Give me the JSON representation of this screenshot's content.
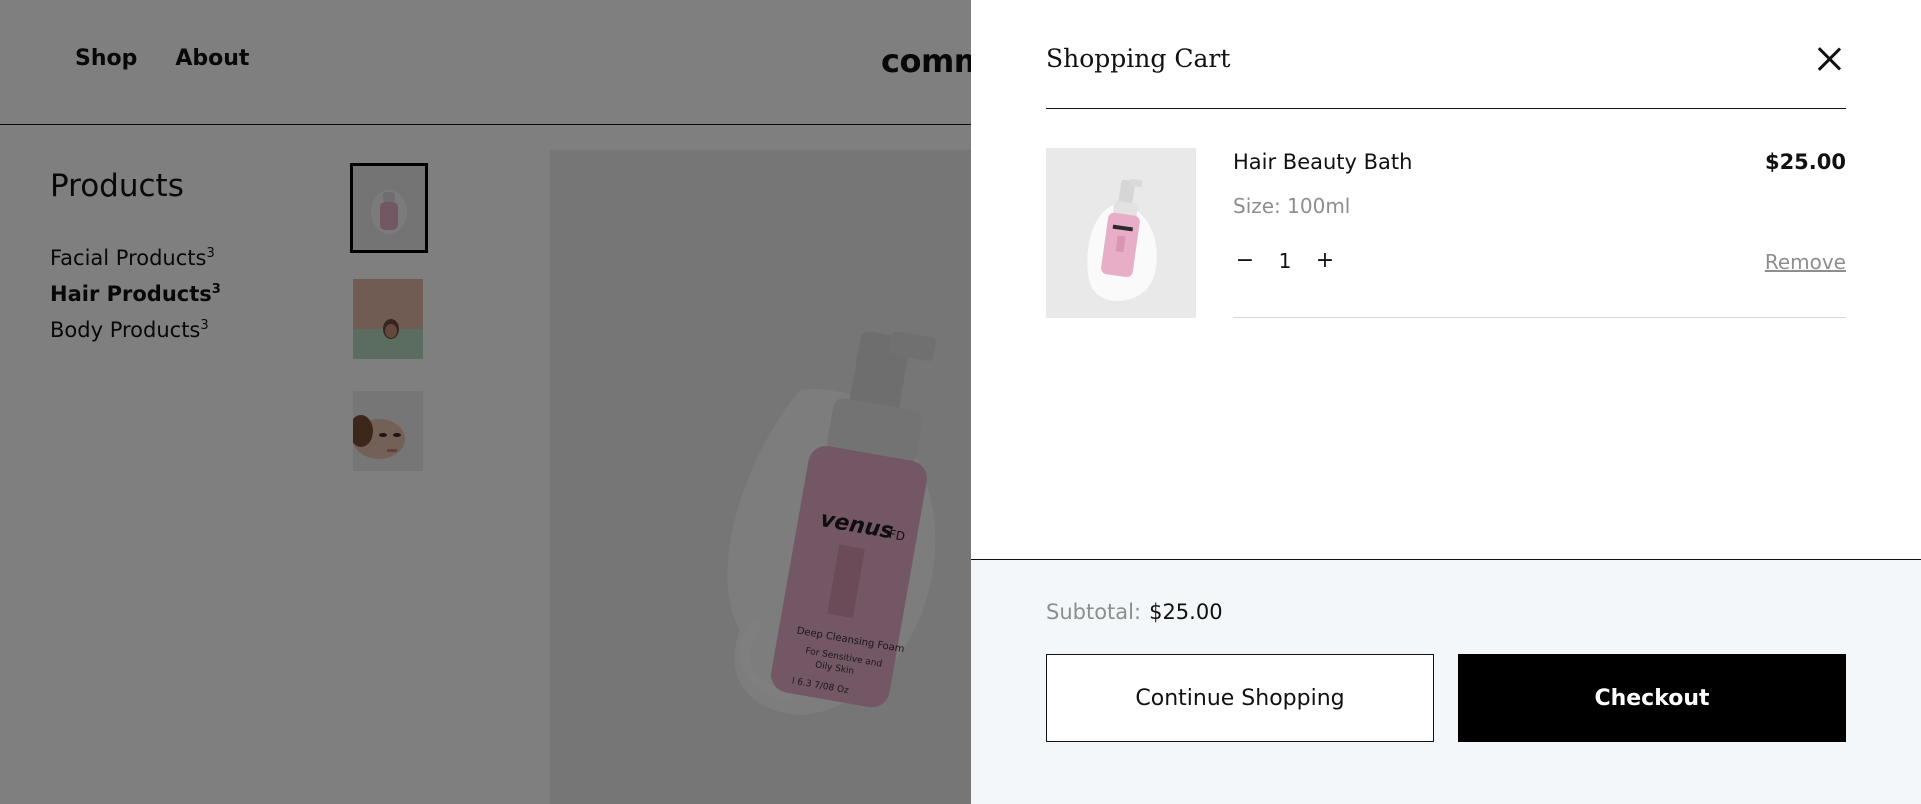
{
  "header": {
    "nav": [
      {
        "label": "Shop"
      },
      {
        "label": "About"
      }
    ],
    "logo_text": "comm"
  },
  "sidebar": {
    "title": "Products",
    "categories": [
      {
        "label": "Facial Products",
        "count": "3",
        "active": false
      },
      {
        "label": "Hair Products",
        "count": "3",
        "active": true
      },
      {
        "label": "Body Products",
        "count": "3",
        "active": false
      }
    ]
  },
  "gallery": {
    "thumbnails": [
      "pink-bottle-thumbnail",
      "bath-woman-thumbnail",
      "woman-face-thumbnail"
    ],
    "hero_image": {
      "brand": "venus",
      "brand_suffix": "FD",
      "product_text": "Deep Cleansing Foam",
      "sub_text": [
        "For Sensitive and",
        "Oily Skin"
      ],
      "volume_text": "l 6.3 7/08 Oz"
    }
  },
  "cart": {
    "title": "Shopping Cart",
    "close_icon": "close-icon",
    "items": [
      {
        "name": "Hair Beauty Bath",
        "price": "$25.00",
        "variant": "Size: 100ml",
        "quantity": "1",
        "decrease_symbol": "−",
        "increase_symbol": "+",
        "remove_label": "Remove"
      }
    ],
    "subtotal_label": "Subtotal:",
    "subtotal_value": "$25.00",
    "continue_label": "Continue Shopping",
    "checkout_label": "Checkout"
  },
  "colors": {
    "overlay": "rgba(0,0,0,0.5)",
    "footer_bg": "#f3f7f9",
    "muted_text": "#8e8e8e",
    "primary": "#000000",
    "product_pink": "#e8aec8"
  }
}
